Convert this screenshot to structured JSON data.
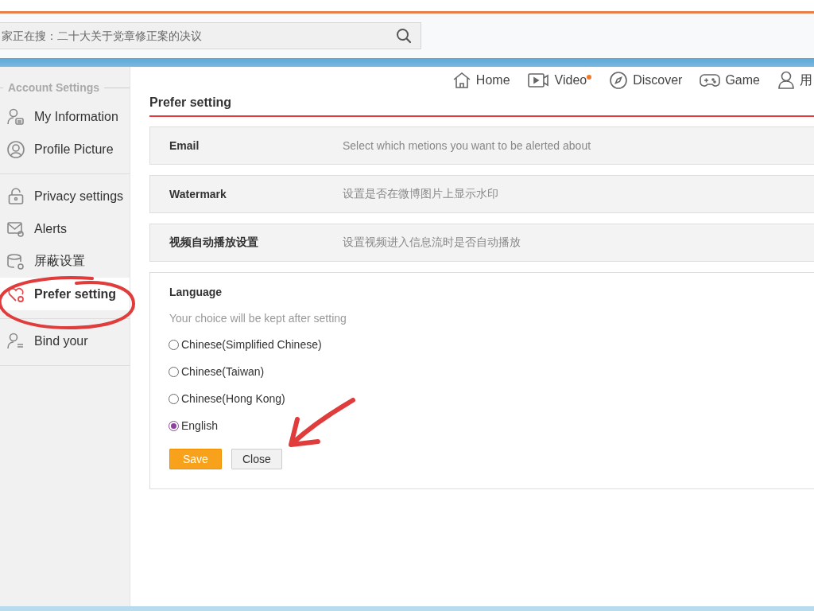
{
  "search": {
    "placeholder": "家正在搜：二十大关于党章修正案的决议"
  },
  "nav": [
    {
      "kind": "home",
      "label": "Home",
      "dot": false
    },
    {
      "kind": "video",
      "label": "Video",
      "dot": true
    },
    {
      "kind": "discover",
      "label": "Discover",
      "dot": false
    },
    {
      "kind": "game",
      "label": "Game",
      "dot": false
    },
    {
      "kind": "user",
      "label": "用",
      "dot": false
    }
  ],
  "sidebar": {
    "heading": "Account Settings",
    "groups": [
      [
        {
          "kind": "info",
          "label": "My Information",
          "selected": false
        },
        {
          "kind": "avatar",
          "label": "Profile Picture",
          "selected": false
        }
      ],
      [
        {
          "kind": "lock",
          "label": "Privacy settings",
          "selected": false
        },
        {
          "kind": "mail",
          "label": "Alerts",
          "selected": false
        },
        {
          "kind": "shield",
          "label": "屏蔽设置",
          "selected": false
        },
        {
          "kind": "heart",
          "label": "Prefer setting",
          "selected": true
        }
      ],
      [
        {
          "kind": "bind",
          "label": "Bind your",
          "selected": false
        }
      ]
    ]
  },
  "title": "Prefer setting",
  "rows": [
    {
      "label": "Email",
      "description": "Select which metions you want to be alerted about"
    },
    {
      "label": "Watermark",
      "description": "设置是否在微博图片上显示水印"
    },
    {
      "label": "视频自动播放设置",
      "description": "设置视频进入信息流时是否自动播放"
    }
  ],
  "language": {
    "label": "Language",
    "hint": "Your choice will be kept after setting",
    "options": [
      {
        "label": "Chinese(Simplified Chinese)",
        "selected": false
      },
      {
        "label": "Chinese(Taiwan)",
        "selected": false
      },
      {
        "label": "Chinese(Hong Kong)",
        "selected": false
      },
      {
        "label": "English",
        "selected": true
      }
    ],
    "buttons": [
      {
        "kind": "primary",
        "label": "Save"
      },
      {
        "kind": "secondary",
        "label": "Close"
      }
    ]
  },
  "annotations": [
    {
      "kind": "circle"
    },
    {
      "kind": "arrow"
    }
  ]
}
